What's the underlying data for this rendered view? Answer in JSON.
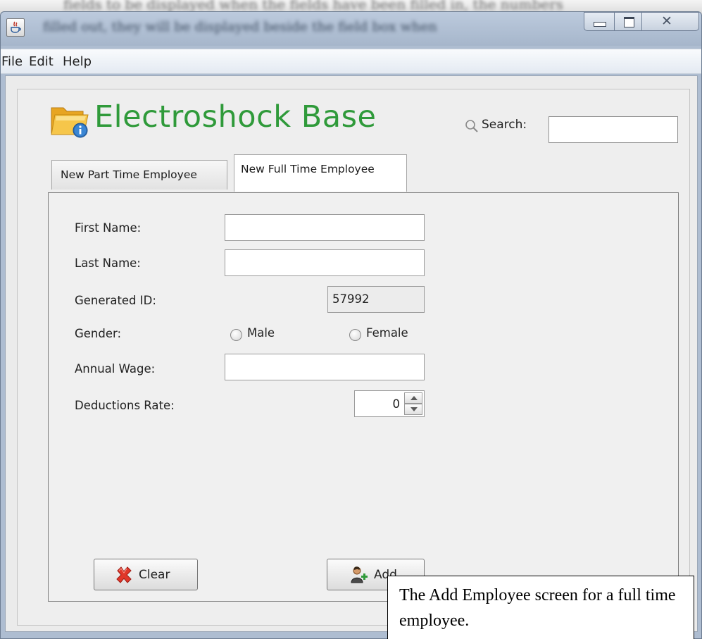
{
  "window": {
    "blurred_title": "filled out, they will be displayed beside the field box when",
    "background_text": "fields to be displayed when the fields have been filled in, the numbers",
    "close_glyph": "✕",
    "icons": {
      "app": "java-coffee-icon",
      "minimize": "minimize-icon",
      "maximize": "maximize-icon",
      "close": "close-icon"
    }
  },
  "menu": {
    "file": "File",
    "edit": "Edit",
    "help": "Help"
  },
  "header": {
    "app_name": "Electroshock Base",
    "app_name_color": "#2f9a3a",
    "search_label": "Search:",
    "search_value": "",
    "icons": {
      "logo": "folder-info-icon",
      "search": "search-icon"
    }
  },
  "tabs": [
    {
      "label": "New Part Time Employee",
      "active": false
    },
    {
      "label": "New Full Time Employee",
      "active": true
    }
  ],
  "form": {
    "first_name_label": "First Name:",
    "first_name_value": "",
    "last_name_label": "Last Name:",
    "last_name_value": "",
    "generated_id_label": "Generated ID:",
    "generated_id_value": "57992",
    "gender_label": "Gender:",
    "gender_options": [
      "Male",
      "Female"
    ],
    "gender_selected": null,
    "annual_wage_label": "Annual Wage:",
    "annual_wage_value": "",
    "deductions_label": "Deductions Rate:",
    "deductions_value": "0"
  },
  "buttons": {
    "clear_label": "Clear",
    "add_label": "Add",
    "icons": {
      "clear": "red-x-icon",
      "add": "add-user-icon"
    }
  },
  "caption": "The Add Employee screen for a full time employee."
}
